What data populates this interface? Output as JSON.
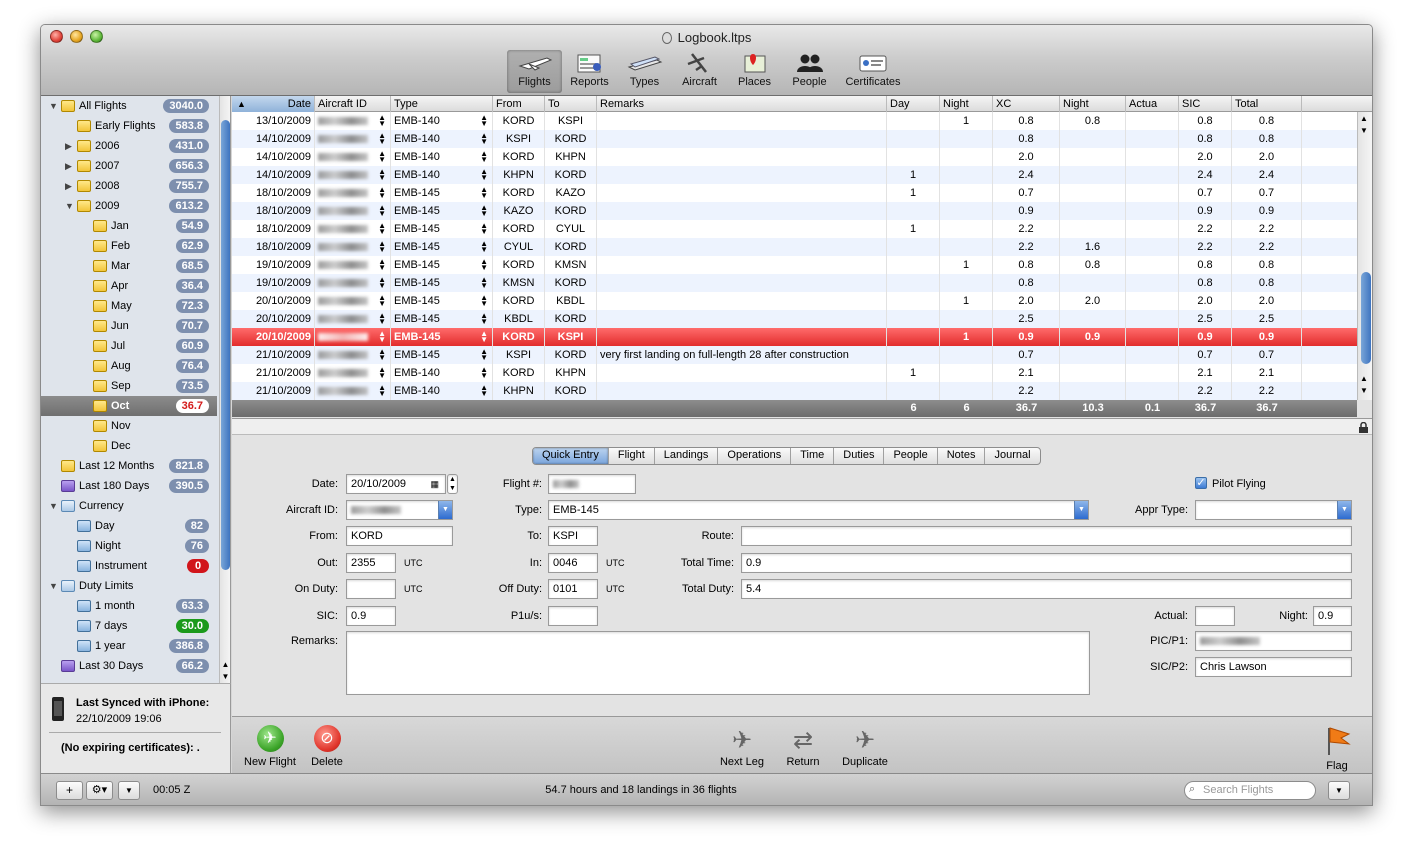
{
  "window": {
    "title": "Logbook.ltps"
  },
  "toolbar": [
    {
      "label": "Flights",
      "icon": "flights-icon"
    },
    {
      "label": "Reports",
      "icon": "reports-icon"
    },
    {
      "label": "Types",
      "icon": "types-icon"
    },
    {
      "label": "Aircraft",
      "icon": "aircraft-icon"
    },
    {
      "label": "Places",
      "icon": "places-icon"
    },
    {
      "label": "People",
      "icon": "people-icon"
    },
    {
      "label": "Certificates",
      "icon": "certificates-icon"
    }
  ],
  "sidebar": {
    "items": [
      {
        "label": "All Flights",
        "badge": "3040.0",
        "indent": 0,
        "tri": "▼",
        "icon": "yellow"
      },
      {
        "label": "Early Flights",
        "badge": "583.8",
        "indent": 1,
        "tri": "",
        "icon": "yellow"
      },
      {
        "label": "2006",
        "badge": "431.0",
        "indent": 1,
        "tri": "▶",
        "icon": "yellow"
      },
      {
        "label": "2007",
        "badge": "656.3",
        "indent": 1,
        "tri": "▶",
        "icon": "yellow"
      },
      {
        "label": "2008",
        "badge": "755.7",
        "indent": 1,
        "tri": "▶",
        "icon": "yellow"
      },
      {
        "label": "2009",
        "badge": "613.2",
        "indent": 1,
        "tri": "▼",
        "icon": "yellow"
      },
      {
        "label": "Jan",
        "badge": "54.9",
        "indent": 2,
        "tri": "",
        "icon": "yellow"
      },
      {
        "label": "Feb",
        "badge": "62.9",
        "indent": 2,
        "tri": "",
        "icon": "yellow"
      },
      {
        "label": "Mar",
        "badge": "68.5",
        "indent": 2,
        "tri": "",
        "icon": "yellow"
      },
      {
        "label": "Apr",
        "badge": "36.4",
        "indent": 2,
        "tri": "",
        "icon": "yellow"
      },
      {
        "label": "May",
        "badge": "72.3",
        "indent": 2,
        "tri": "",
        "icon": "yellow"
      },
      {
        "label": "Jun",
        "badge": "70.7",
        "indent": 2,
        "tri": "",
        "icon": "yellow"
      },
      {
        "label": "Jul",
        "badge": "60.9",
        "indent": 2,
        "tri": "",
        "icon": "yellow"
      },
      {
        "label": "Aug",
        "badge": "76.4",
        "indent": 2,
        "tri": "",
        "icon": "yellow"
      },
      {
        "label": "Sep",
        "badge": "73.5",
        "indent": 2,
        "tri": "",
        "icon": "yellow"
      },
      {
        "label": "Oct",
        "badge": "36.7",
        "indent": 2,
        "tri": "",
        "icon": "yellow",
        "selected": true
      },
      {
        "label": "Nov",
        "badge": "",
        "indent": 2,
        "tri": "",
        "icon": "yellow"
      },
      {
        "label": "Dec",
        "badge": "",
        "indent": 2,
        "tri": "",
        "icon": "yellow"
      },
      {
        "label": "Last 12 Months",
        "badge": "821.8",
        "indent": 0,
        "tri": "",
        "icon": "yellow"
      },
      {
        "label": "Last 180 Days",
        "badge": "390.5",
        "indent": 0,
        "tri": "",
        "icon": "purple"
      },
      {
        "label": "Currency",
        "badge": "",
        "indent": 0,
        "tri": "▼",
        "icon": "fold"
      },
      {
        "label": "Day",
        "badge": "82",
        "indent": 1,
        "tri": "",
        "icon": "blue"
      },
      {
        "label": "Night",
        "badge": "76",
        "indent": 1,
        "tri": "",
        "icon": "blue"
      },
      {
        "label": "Instrument",
        "badge": "0",
        "indent": 1,
        "tri": "",
        "icon": "blue",
        "badgeColor": "red"
      },
      {
        "label": "Duty Limits",
        "badge": "",
        "indent": 0,
        "tri": "▼",
        "icon": "fold"
      },
      {
        "label": "1 month",
        "badge": "63.3",
        "indent": 1,
        "tri": "",
        "icon": "blue"
      },
      {
        "label": "7 days",
        "badge": "30.0",
        "indent": 1,
        "tri": "",
        "icon": "blue",
        "badgeColor": "green"
      },
      {
        "label": "1 year",
        "badge": "386.8",
        "indent": 1,
        "tri": "",
        "icon": "blue"
      },
      {
        "label": "Last 30 Days",
        "badge": "66.2",
        "indent": 0,
        "tri": "",
        "icon": "purple"
      }
    ],
    "sync_line1": "Last Synced with iPhone:",
    "sync_line2": "22/10/2009 19:06",
    "certs": "(No expiring certificates): ."
  },
  "table": {
    "headers": [
      "Date",
      "Aircraft ID",
      "Type",
      "From",
      "To",
      "Remarks",
      "Day",
      "Night",
      "XC",
      "Night",
      "Actua",
      "SIC",
      "Total"
    ],
    "rows": [
      [
        "13/10/2009",
        "",
        "EMB-140",
        "KORD",
        "KSPI",
        "",
        "",
        "1",
        "0.8",
        "0.8",
        "",
        "0.8",
        "0.8"
      ],
      [
        "14/10/2009",
        "",
        "EMB-140",
        "KSPI",
        "KORD",
        "",
        "",
        "",
        "0.8",
        "",
        "",
        "0.8",
        "0.8"
      ],
      [
        "14/10/2009",
        "",
        "EMB-140",
        "KORD",
        "KHPN",
        "",
        "",
        "",
        "2.0",
        "",
        "",
        "2.0",
        "2.0"
      ],
      [
        "14/10/2009",
        "",
        "EMB-140",
        "KHPN",
        "KORD",
        "",
        "1",
        "",
        "2.4",
        "",
        "",
        "2.4",
        "2.4"
      ],
      [
        "18/10/2009",
        "",
        "EMB-145",
        "KORD",
        "KAZO",
        "",
        "1",
        "",
        "0.7",
        "",
        "",
        "0.7",
        "0.7"
      ],
      [
        "18/10/2009",
        "",
        "EMB-145",
        "KAZO",
        "KORD",
        "",
        "",
        "",
        "0.9",
        "",
        "",
        "0.9",
        "0.9"
      ],
      [
        "18/10/2009",
        "",
        "EMB-145",
        "KORD",
        "CYUL",
        "",
        "1",
        "",
        "2.2",
        "",
        "",
        "2.2",
        "2.2"
      ],
      [
        "18/10/2009",
        "",
        "EMB-145",
        "CYUL",
        "KORD",
        "",
        "",
        "",
        "2.2",
        "1.6",
        "",
        "2.2",
        "2.2"
      ],
      [
        "19/10/2009",
        "",
        "EMB-145",
        "KORD",
        "KMSN",
        "",
        "",
        "1",
        "0.8",
        "0.8",
        "",
        "0.8",
        "0.8"
      ],
      [
        "19/10/2009",
        "",
        "EMB-145",
        "KMSN",
        "KORD",
        "",
        "",
        "",
        "0.8",
        "",
        "",
        "0.8",
        "0.8"
      ],
      [
        "20/10/2009",
        "",
        "EMB-145",
        "KORD",
        "KBDL",
        "",
        "",
        "1",
        "2.0",
        "2.0",
        "",
        "2.0",
        "2.0"
      ],
      [
        "20/10/2009",
        "",
        "EMB-145",
        "KBDL",
        "KORD",
        "",
        "",
        "",
        "2.5",
        "",
        "",
        "2.5",
        "2.5"
      ],
      [
        "20/10/2009",
        "",
        "EMB-145",
        "KORD",
        "KSPI",
        "",
        "",
        "1",
        "0.9",
        "0.9",
        "",
        "0.9",
        "0.9"
      ],
      [
        "21/10/2009",
        "",
        "EMB-145",
        "KSPI",
        "KORD",
        "very first landing on full-length 28 after construction",
        "",
        "",
        "0.7",
        "",
        "",
        "0.7",
        "0.7"
      ],
      [
        "21/10/2009",
        "",
        "EMB-140",
        "KORD",
        "KHPN",
        "",
        "1",
        "",
        "2.1",
        "",
        "",
        "2.1",
        "2.1"
      ],
      [
        "21/10/2009",
        "",
        "EMB-140",
        "KHPN",
        "KORD",
        "",
        "",
        "",
        "2.2",
        "",
        "",
        "2.2",
        "2.2"
      ]
    ],
    "selected_row": 12,
    "totals": [
      "",
      "",
      "",
      "",
      "",
      "",
      "6",
      "6",
      "36.7",
      "10.3",
      "0.1",
      "36.7",
      "36.7"
    ]
  },
  "tabs": [
    "Quick Entry",
    "Flight",
    "Landings",
    "Operations",
    "Time",
    "Duties",
    "People",
    "Notes",
    "Journal"
  ],
  "form": {
    "date_label": "Date:",
    "date": "20/10/2009",
    "aircraft_label": "Aircraft ID:",
    "aircraft": "",
    "from_label": "From:",
    "from": "KORD",
    "out_label": "Out:",
    "out": "2355",
    "onduty_label": "On Duty:",
    "onduty": "",
    "sic_label": "SIC:",
    "sic": "0.9",
    "remarks_label": "Remarks:",
    "remarks": "",
    "flightno_label": "Flight #:",
    "flightno": "",
    "type_label": "Type:",
    "type": "EMB-145",
    "to_label": "To:",
    "to": "KSPI",
    "in_label": "In:",
    "in": "0046",
    "offduty_label": "Off Duty:",
    "offduty": "0101",
    "p1us_label": "P1u/s:",
    "p1us": "",
    "route_label": "Route:",
    "route": "",
    "totaltime_label": "Total Time:",
    "totaltime": "0.9",
    "totalduty_label": "Total Duty:",
    "totalduty": "5.4",
    "utc": "UTC",
    "pilotflying_label": "Pilot Flying",
    "apprtype_label": "Appr Type:",
    "apprtype": "",
    "actual_label": "Actual:",
    "actual": "",
    "night_label": "Night:",
    "night": "0.9",
    "picp1_label": "PIC/P1:",
    "picp1": "",
    "sicp2_label": "SIC/P2:",
    "sicp2": "Chris Lawson"
  },
  "actions": {
    "new_flight": "New Flight",
    "delete": "Delete",
    "next_leg": "Next Leg",
    "return": "Return",
    "duplicate": "Duplicate",
    "flag": "Flag"
  },
  "status": {
    "clock": "00:05 Z",
    "summary": "54.7 hours and 18 landings in 36 flights",
    "search_placeholder": "Search Flights"
  },
  "colors": {
    "selection": "#e22c2c",
    "badge": "#7d8fae",
    "accent": "#3e74c0"
  }
}
